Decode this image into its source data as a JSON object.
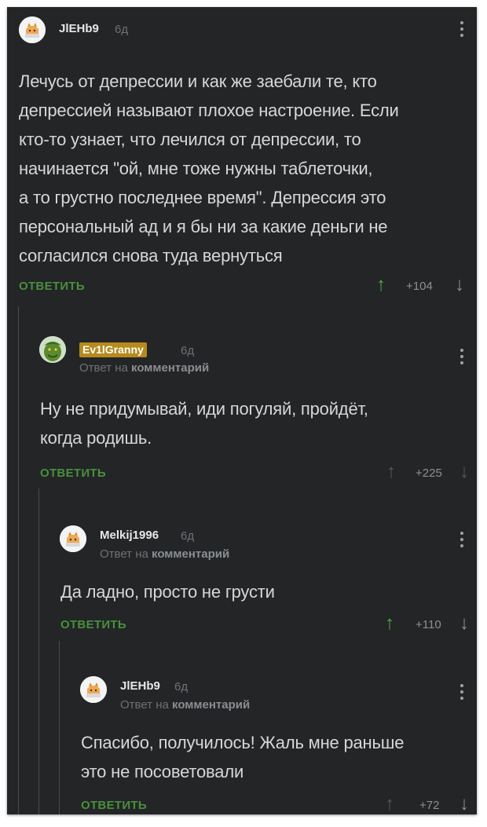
{
  "comments": [
    {
      "author": "JlEHb9",
      "time": "6д",
      "text_lines": [
        "Лечусь от депрессии и как же заебали те, кто",
        "депрессией называют плохое настроение. Если",
        "кто-то узнает, что лечился от депрессии, то",
        "начинается \"ой, мне тоже нужны таблеточки,",
        "а то грустно последнее время\". Депрессия это",
        "персональный ад и я бы ни за какие деньги не",
        "согласился снова туда вернуться"
      ],
      "reply_label": "ОТВЕТИТЬ",
      "score": "+104",
      "vote": "up"
    },
    {
      "author": "Ev1lGranny",
      "time": "6д",
      "reply_prefix": "Ответ на",
      "reply_target": "комментарий",
      "text_lines": [
        "Ну не придумывай, иди погуляй, пройдёт,",
        "когда родишь."
      ],
      "reply_label": "ОТВЕТИТЬ",
      "score": "+225",
      "vote": "none"
    },
    {
      "author": "Melkij1996",
      "time": "6д",
      "reply_prefix": "Ответ на",
      "reply_target": "комментарий",
      "text_lines": [
        "Да ладно, просто не грусти"
      ],
      "reply_label": "ОТВЕТИТЬ",
      "score": "+110",
      "vote": "up"
    },
    {
      "author": "JlEHb9",
      "time": "6д",
      "reply_prefix": "Ответ на",
      "reply_target": "комментарий",
      "text_lines": [
        "Спасибо, получилось! Жаль мне раньше",
        "это не посоветовали"
      ],
      "reply_label": "ОТВЕТИТЬ",
      "score": "+72",
      "vote": "none"
    }
  ],
  "icons": {
    "vote_up": "arrow-up-icon",
    "vote_down": "arrow-down-icon",
    "more": "more-vertical-icon"
  },
  "colors": {
    "background": "#232527",
    "reply": "#4a8f3c",
    "upvote_active": "#4caf3c",
    "badge": "#b68a1c"
  }
}
